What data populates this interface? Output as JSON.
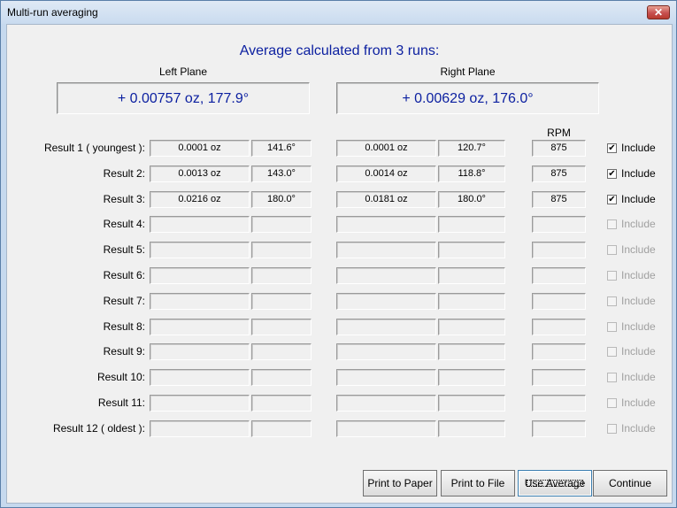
{
  "window": {
    "title": "Multi-run averaging",
    "close_glyph": "✕"
  },
  "heading": "Average calculated from 3 runs:",
  "planes": {
    "left_label": "Left Plane",
    "right_label": "Right Plane",
    "left_average": "+ 0.00757 oz, 177.9°",
    "right_average": "+ 0.00629 oz, 176.0°"
  },
  "rpm_header": "RPM",
  "include_label": "Include",
  "checked_glyph": "✔",
  "rows": [
    {
      "label": "Result 1 ( youngest ):",
      "left_amount": "0.0001 oz",
      "left_angle": "141.6°",
      "right_amount": "0.0001 oz",
      "right_angle": "120.7°",
      "rpm": "875",
      "included": true,
      "enabled": true
    },
    {
      "label": "Result 2:",
      "left_amount": "0.0013 oz",
      "left_angle": "143.0°",
      "right_amount": "0.0014 oz",
      "right_angle": "118.8°",
      "rpm": "875",
      "included": true,
      "enabled": true
    },
    {
      "label": "Result 3:",
      "left_amount": "0.0216 oz",
      "left_angle": "180.0°",
      "right_amount": "0.0181 oz",
      "right_angle": "180.0°",
      "rpm": "875",
      "included": true,
      "enabled": true
    },
    {
      "label": "Result 4:",
      "left_amount": "",
      "left_angle": "",
      "right_amount": "",
      "right_angle": "",
      "rpm": "",
      "included": false,
      "enabled": false
    },
    {
      "label": "Result 5:",
      "left_amount": "",
      "left_angle": "",
      "right_amount": "",
      "right_angle": "",
      "rpm": "",
      "included": false,
      "enabled": false
    },
    {
      "label": "Result 6:",
      "left_amount": "",
      "left_angle": "",
      "right_amount": "",
      "right_angle": "",
      "rpm": "",
      "included": false,
      "enabled": false
    },
    {
      "label": "Result 7:",
      "left_amount": "",
      "left_angle": "",
      "right_amount": "",
      "right_angle": "",
      "rpm": "",
      "included": false,
      "enabled": false
    },
    {
      "label": "Result 8:",
      "left_amount": "",
      "left_angle": "",
      "right_amount": "",
      "right_angle": "",
      "rpm": "",
      "included": false,
      "enabled": false
    },
    {
      "label": "Result 9:",
      "left_amount": "",
      "left_angle": "",
      "right_amount": "",
      "right_angle": "",
      "rpm": "",
      "included": false,
      "enabled": false
    },
    {
      "label": "Result 10:",
      "left_amount": "",
      "left_angle": "",
      "right_amount": "",
      "right_angle": "",
      "rpm": "",
      "included": false,
      "enabled": false
    },
    {
      "label": "Result 11:",
      "left_amount": "",
      "left_angle": "",
      "right_amount": "",
      "right_angle": "",
      "rpm": "",
      "included": false,
      "enabled": false
    },
    {
      "label": "Result 12 ( oldest ):",
      "left_amount": "",
      "left_angle": "",
      "right_amount": "",
      "right_angle": "",
      "rpm": "",
      "included": false,
      "enabled": false
    }
  ],
  "buttons": {
    "print_paper": "Print to Paper",
    "print_file": "Print to File",
    "use_average": "Use Average",
    "continue": "Continue"
  }
}
